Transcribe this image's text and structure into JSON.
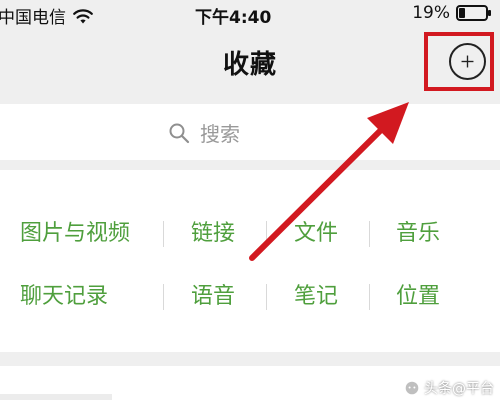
{
  "status_bar": {
    "carrier": "中国电信",
    "time": "下午4:40",
    "battery": "19%"
  },
  "header": {
    "title": "收藏"
  },
  "search": {
    "placeholder": "搜索"
  },
  "categories": [
    "图片与视频",
    "链接",
    "文件",
    "音乐",
    "聊天记录",
    "语音",
    "笔记",
    "位置"
  ],
  "watermark": {
    "text": "头条@平台"
  },
  "colors": {
    "category_text": "#4f9f3d",
    "highlight": "#d21920",
    "background": "#efefef"
  },
  "icons": {
    "wifi": "wifi-icon",
    "battery": "battery-icon",
    "add": "plus-circle-icon",
    "search": "search-icon"
  }
}
